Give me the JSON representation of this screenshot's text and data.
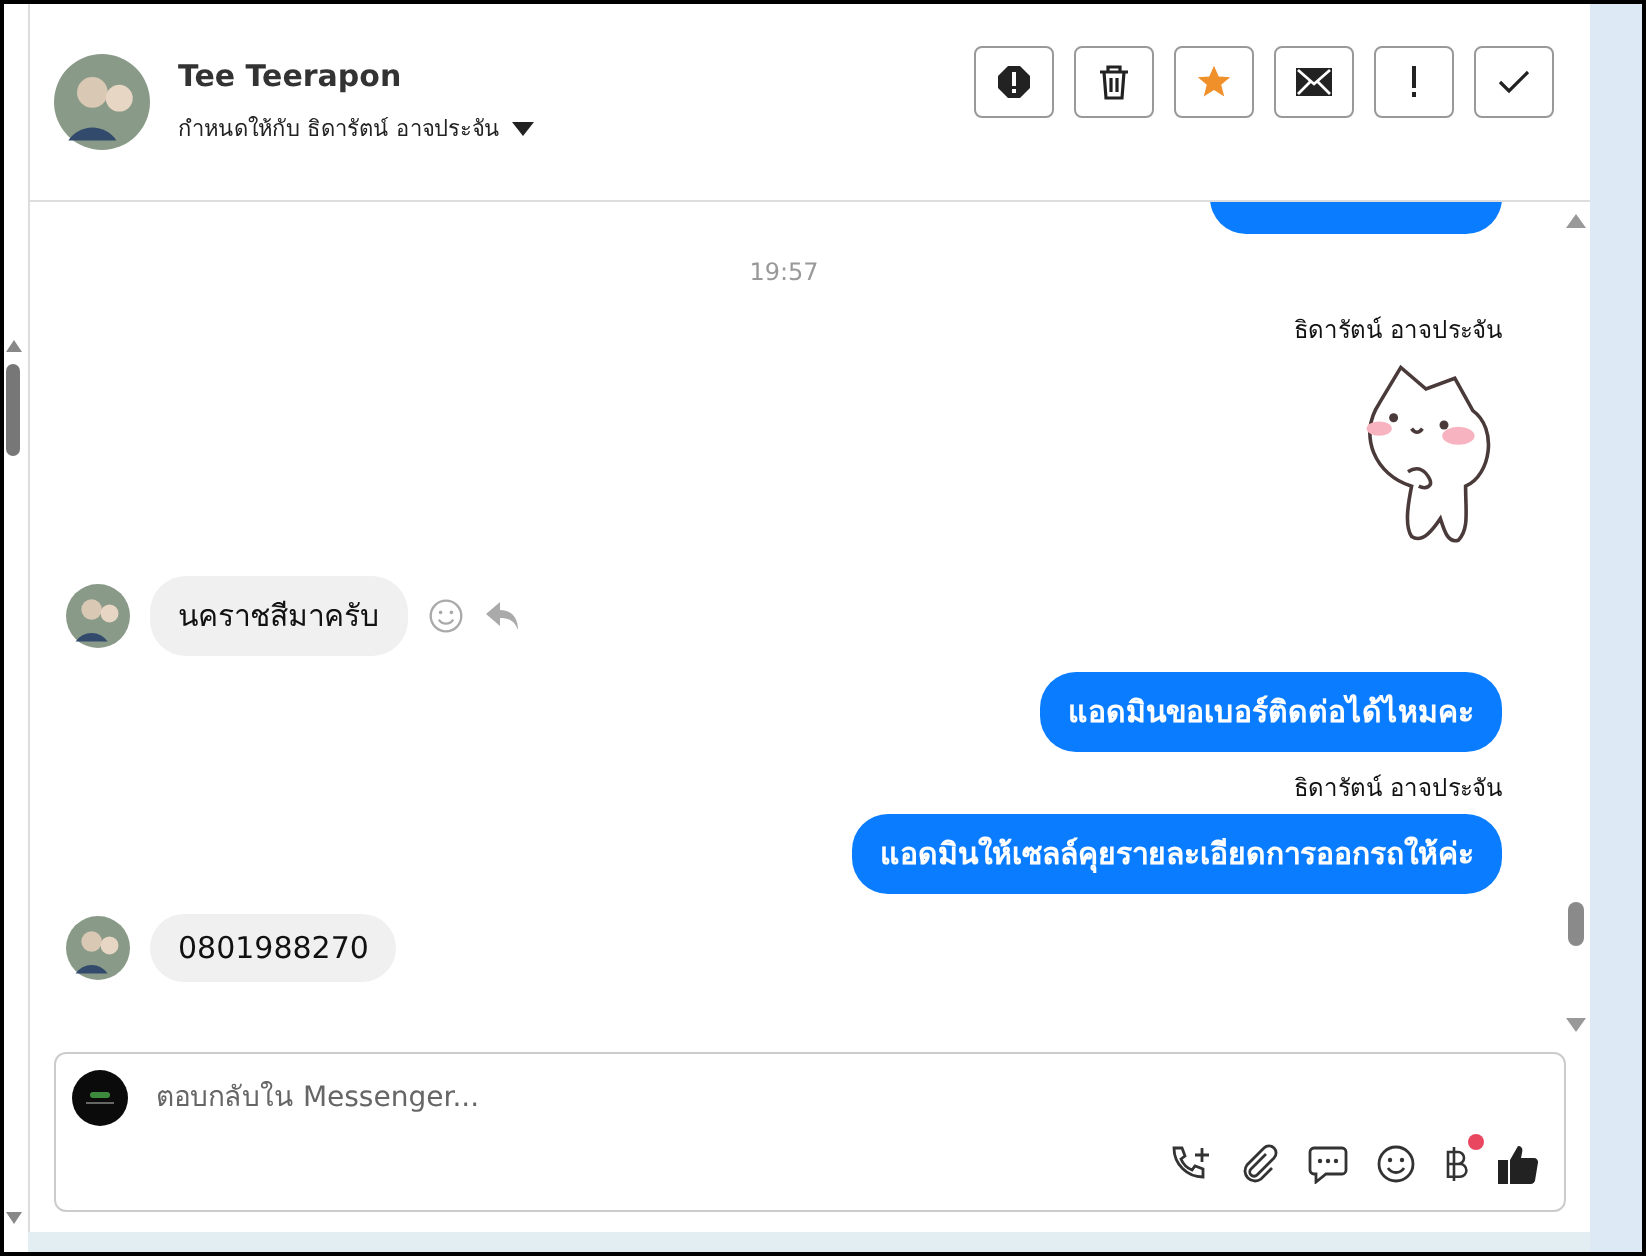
{
  "header": {
    "name": "Tee Teerapon",
    "assigned_to": "กำหนดให้กับ ธิดารัตน์ อาจประจัน",
    "actions": [
      {
        "kind": "spam",
        "on": false
      },
      {
        "kind": "delete",
        "on": false
      },
      {
        "kind": "star",
        "on": true
      },
      {
        "kind": "mail",
        "on": false
      },
      {
        "kind": "important",
        "on": false
      },
      {
        "kind": "done",
        "on": false
      }
    ]
  },
  "messages": [
    {
      "kind": "outgoing_cut"
    },
    {
      "kind": "time",
      "text": "19:57"
    },
    {
      "kind": "sender",
      "text": "ธิดารัตน์ อาจประจัน"
    },
    {
      "kind": "sticker"
    },
    {
      "kind": "incoming",
      "text": "นคราชสีมาครับ",
      "actions": true
    },
    {
      "kind": "outgoing",
      "text": "แอดมินขอเบอร์ติดต่อได้ไหมคะ"
    },
    {
      "kind": "sender",
      "text": "ธิดารัตน์ อาจประจัน"
    },
    {
      "kind": "outgoing",
      "text": "แอดมินให้เซลล์คุยรายละเอียดการออกรถให้ค่ะ"
    },
    {
      "kind": "incoming",
      "text": "0801988270",
      "actions": false
    }
  ],
  "composer": {
    "placeholder": "ตอบกลับใน Messenger...",
    "tools": [
      {
        "kind": "call",
        "badge": false
      },
      {
        "kind": "attach",
        "badge": false
      },
      {
        "kind": "chat",
        "badge": false
      },
      {
        "kind": "emoji",
        "badge": false
      },
      {
        "kind": "baht",
        "badge": true
      },
      {
        "kind": "like",
        "badge": false
      }
    ]
  }
}
